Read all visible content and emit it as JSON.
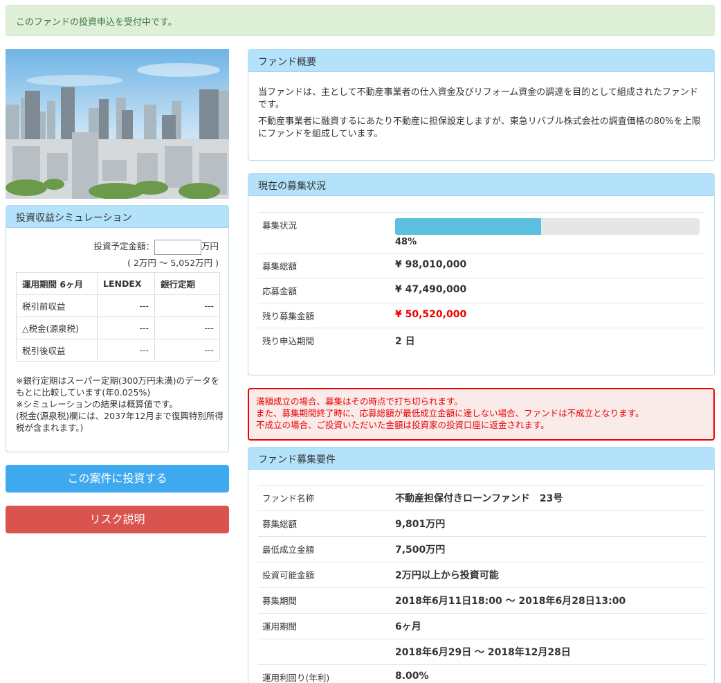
{
  "notice": "このファンドの投資申込を受付中です。",
  "simulation": {
    "title": "投資収益シミュレーション",
    "amount_label": "投資予定金額：",
    "amount_value": "",
    "amount_unit": "万円",
    "range": "( 2万円 ～ 5,052万円 )",
    "headers": [
      "運用期間 6ヶ月",
      "LENDEX",
      "銀行定期"
    ],
    "rows": [
      {
        "label": "税引前収益",
        "lendex": "---",
        "bank": "---"
      },
      {
        "label": "△税金(源泉税)",
        "lendex": "---",
        "bank": "---"
      },
      {
        "label": "税引後収益",
        "lendex": "---",
        "bank": "---"
      }
    ],
    "notes": [
      "※銀行定期はスーパー定期(300万円未満)のデータをもとに比較しています(年0.025%)",
      "※シミュレーションの結果は概算値です。",
      "(税金(源泉税)欄には、2037年12月まで復興特別所得税が含まれます。)"
    ]
  },
  "buttons": {
    "invest": "この案件に投資する",
    "risk": "リスク説明"
  },
  "overview": {
    "title": "ファンド概要",
    "paragraphs": [
      "当ファンドは、主として不動産事業者の仕入資金及びリフォーム資金の調達を目的として組成されたファンドです。",
      "不動産事業者に融資するにあたり不動産に担保設定しますが、東急リバブル株式会社の調査価格の80%を上限にファンドを組成しています。"
    ]
  },
  "status": {
    "title": "現在の募集状況",
    "progress_label": "募集状況",
    "progress_percent": 48,
    "progress_text": "48%",
    "rows": [
      {
        "label": "募集総額",
        "value": "¥ 98,010,000"
      },
      {
        "label": "応募金額",
        "value": "¥ 47,490,000"
      },
      {
        "label": "残り募集金額",
        "value": "¥ 50,520,000"
      },
      {
        "label": "残り申込期間",
        "value": "2 日"
      }
    ]
  },
  "warning": [
    "満額成立の場合、募集はその時点で打ち切られます。",
    "また、募集期間終了時に、応募総額が最低成立金額に達しない場合、ファンドは不成立となります。",
    "不成立の場合、ご投資いただいた金額は投資家の投資口座に返金されます。"
  ],
  "terms": {
    "title": "ファンド募集要件",
    "rows": [
      {
        "label": "ファンド名称",
        "value": "不動産担保付きローンファンド　23号"
      },
      {
        "label": "募集総額",
        "value": "9,801万円"
      },
      {
        "label": "最低成立金額",
        "value": "7,500万円"
      },
      {
        "label": "投資可能金額",
        "value": "2万円以上から投資可能"
      },
      {
        "label": "募集期間",
        "value": "2018年6月11日18:00 ～ 2018年6月28日13:00"
      },
      {
        "label": "運用期間",
        "value": "6ヶ月"
      },
      {
        "label": "",
        "value": "2018年6月29日 ～ 2018年12月28日"
      },
      {
        "label": "運用利回り(年利)",
        "value": "8.00%"
      }
    ]
  }
}
